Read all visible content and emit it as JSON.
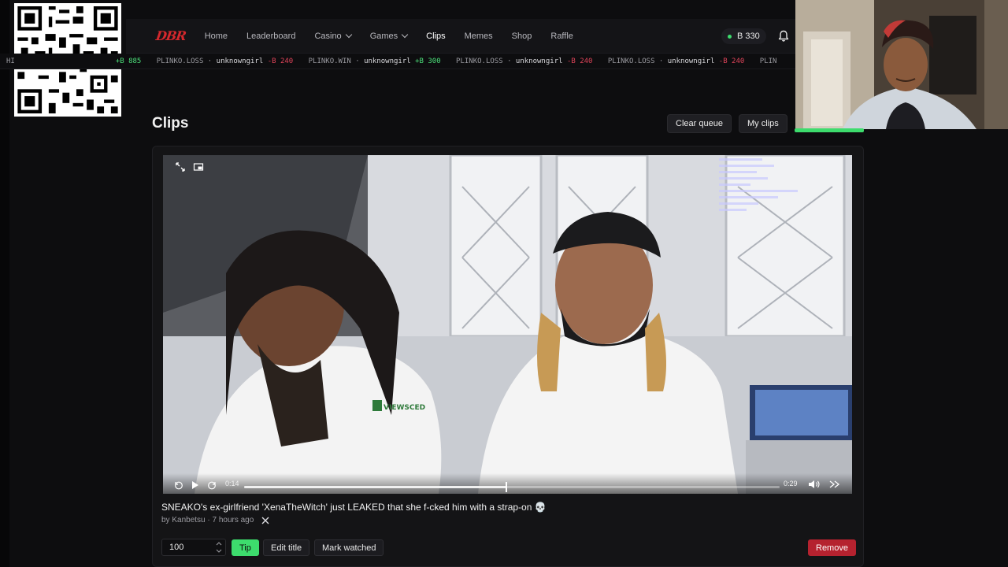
{
  "nav": {
    "logo": "DBR",
    "links": [
      {
        "label": "Home"
      },
      {
        "label": "Leaderboard"
      },
      {
        "label": "Casino",
        "dropdown": true
      },
      {
        "label": "Games",
        "dropdown": true
      },
      {
        "label": "Clips",
        "active": true
      },
      {
        "label": "Memes"
      },
      {
        "label": "Shop"
      },
      {
        "label": "Raffle"
      }
    ],
    "balance": "B 330"
  },
  "ticker": {
    "lead_fragment": "HI",
    "lead_amount": "+B 885",
    "items": [
      {
        "game": "PLINKO.LOSS",
        "user": "unknowngirl",
        "amount": "-B 240",
        "kind": "loss"
      },
      {
        "game": "PLINKO.WIN",
        "user": "unknowngirl",
        "amount": "+B 300",
        "kind": "win"
      },
      {
        "game": "PLINKO.LOSS",
        "user": "unknowngirl",
        "amount": "-B 240",
        "kind": "loss"
      },
      {
        "game": "PLINKO.LOSS",
        "user": "unknowngirl",
        "amount": "-B 240",
        "kind": "loss"
      },
      {
        "game": "PLIN",
        "user": "",
        "amount": "",
        "kind": "partial"
      }
    ]
  },
  "page": {
    "title": "Clips",
    "clear_queue": "Clear queue",
    "my_clips": "My clips"
  },
  "player": {
    "current_time": "0:14",
    "duration": "0:29",
    "progress": 0.49,
    "watermark": "VIEWSCED"
  },
  "clip": {
    "title": "SNEAKO's ex-girlfriend 'XenaTheWitch' just LEAKED that she f-cked him with a strap-on 💀",
    "meta": "by Kanbetsu · 7 hours ago"
  },
  "actions": {
    "tip_amount": "100",
    "tip": "Tip",
    "edit_title": "Edit title",
    "mark_watched": "Mark watched",
    "remove": "Remove"
  },
  "colors": {
    "accent_green": "#3ddc6d",
    "danger_red": "#b5222f",
    "brand_red": "#d5282d"
  }
}
